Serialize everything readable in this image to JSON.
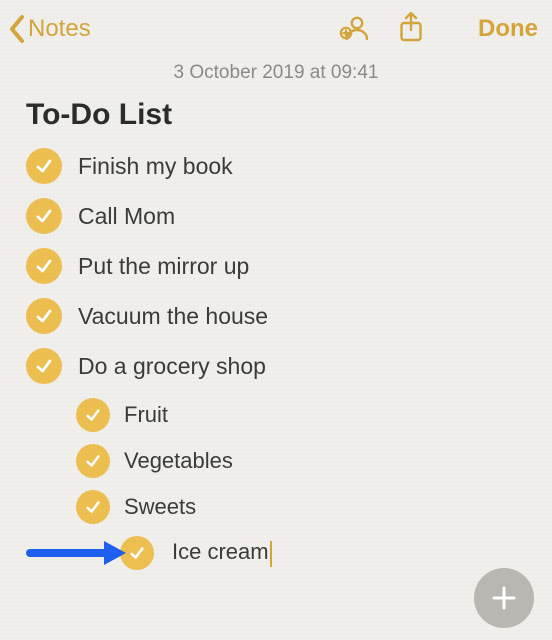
{
  "nav": {
    "back_label": "Notes",
    "done_label": "Done"
  },
  "timestamp": "3 October 2019 at 09:41",
  "title": "To-Do List",
  "items": [
    {
      "text": "Finish my book",
      "checked": true
    },
    {
      "text": "Call Mom",
      "checked": true
    },
    {
      "text": "Put the mirror up",
      "checked": true
    },
    {
      "text": "Vacuum the house",
      "checked": true
    },
    {
      "text": "Do a grocery shop",
      "checked": true
    }
  ],
  "sub_items": [
    {
      "text": "Fruit",
      "checked": true
    },
    {
      "text": "Vegetables",
      "checked": true
    },
    {
      "text": "Sweets",
      "checked": true
    }
  ],
  "editing_item": {
    "text": "Ice cream",
    "checked": true
  },
  "colors": {
    "accent": "#d4a53a",
    "check_fill": "#edbf50",
    "annotation_arrow": "#1f5ff0"
  }
}
